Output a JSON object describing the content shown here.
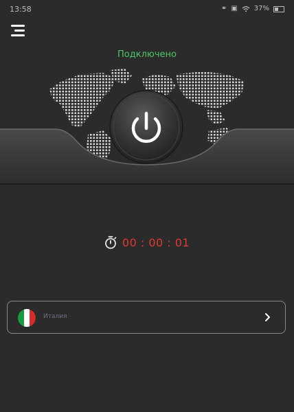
{
  "status_bar": {
    "time": "13:58",
    "battery": "37%",
    "icons": [
      "link-icon",
      "sim-icon",
      "wifi-icon",
      "battery-icon"
    ]
  },
  "menu": {
    "icon": "hamburger-menu-icon"
  },
  "connection": {
    "status": "Подключено",
    "status_color": "#4cc76a"
  },
  "power": {
    "icon": "power-icon",
    "state": "connected"
  },
  "timer": {
    "icon": "stopwatch-icon",
    "value": "00 : 00 : 01",
    "color": "#e23a30"
  },
  "server": {
    "name": "Италия",
    "flag_icon": "italy-flag-icon",
    "flag_colors": [
      "#1a9a3f",
      "#ffffff",
      "#d52b2b"
    ],
    "chevron_icon": "chevron-right-icon"
  }
}
